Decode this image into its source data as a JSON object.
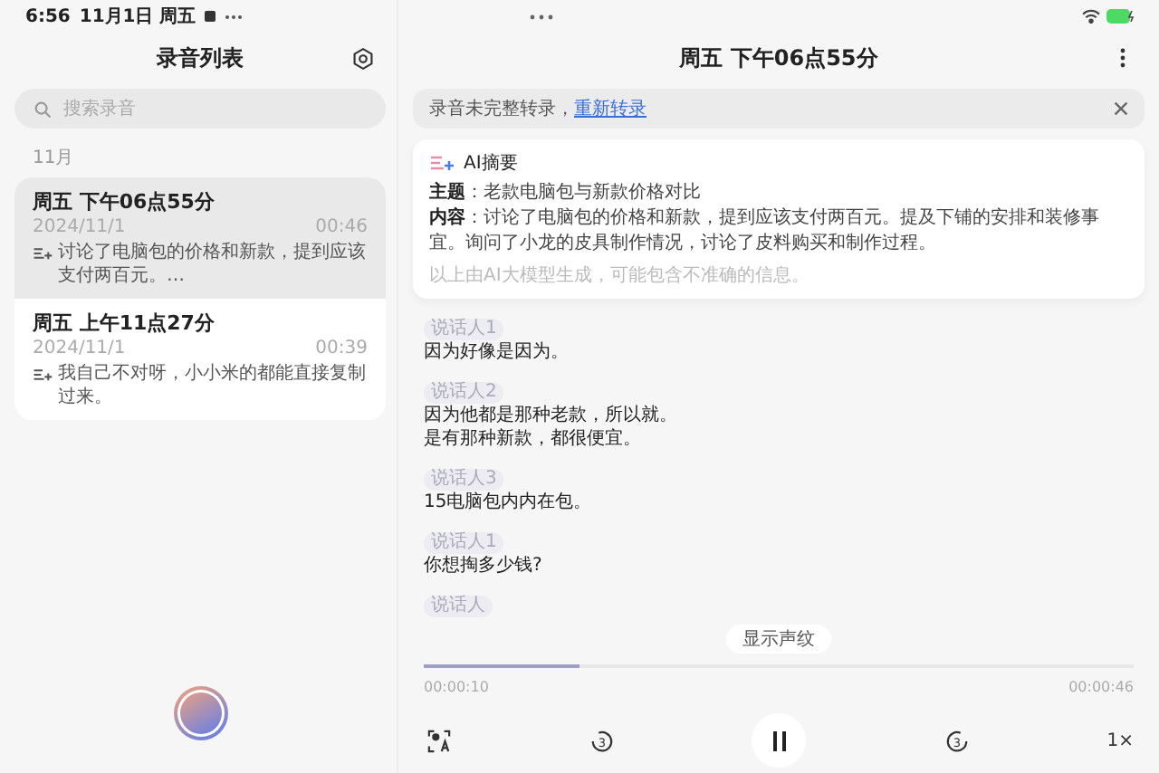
{
  "status_bar": {
    "time": "6:56",
    "date": "11月1日 周五"
  },
  "sidebar": {
    "title": "录音列表",
    "search": {
      "placeholder": "搜索录音"
    },
    "group": "11月",
    "recordings": [
      {
        "title": "周五 下午06点55分",
        "date": "2024/11/1",
        "duration": "00:46",
        "preview": "讨论了电脑包的价格和新款，提到应该支付两百元。…",
        "selected": true
      },
      {
        "title": "周五 上午11点27分",
        "date": "2024/11/1",
        "duration": "00:39",
        "preview": "我自己不对呀，小小米的都能直接复制过来。",
        "selected": false
      }
    ]
  },
  "detail": {
    "title": "周五 下午06点55分",
    "banner": {
      "text": "录音未完整转录，",
      "link": "重新转录"
    },
    "summary": {
      "title": "AI摘要",
      "topic": "**主题**：老款电脑包与新款价格对比",
      "content": "**内容**：讨论了电脑包的价格和新款，提到应该支付两百元。提及下铺的安排和装修事宜。询问了小龙的皮具制作情况，讨论了皮料购买和制作过程。",
      "disclaimer": "以上由AI大模型生成，可能包含不准确的信息。"
    },
    "transcript": [
      {
        "speaker": "说话人1",
        "lines": [
          "因为好像是因为。"
        ]
      },
      {
        "speaker": "说话人2",
        "lines": [
          "因为他都是那种老款，所以就。",
          "是有那种新款，都很便宜。"
        ]
      },
      {
        "speaker": "说话人3",
        "lines": [
          "15电脑包内内在包。"
        ]
      },
      {
        "speaker": "说话人1",
        "lines": [
          "你想掏多少钱?"
        ]
      },
      {
        "speaker": "说话人"
      }
    ],
    "waveform_button": "显示声纹",
    "player": {
      "level": 0.22,
      "elapsed": "00:00:10",
      "total": "00:00:46",
      "controls": [
        {
          "kind": "transcribe"
        },
        {
          "kind": "rewind",
          "label": "3"
        },
        {
          "kind": "pause"
        },
        {
          "kind": "forward",
          "label": "3"
        },
        {
          "kind": "speed",
          "label": "1×"
        }
      ]
    }
  }
}
